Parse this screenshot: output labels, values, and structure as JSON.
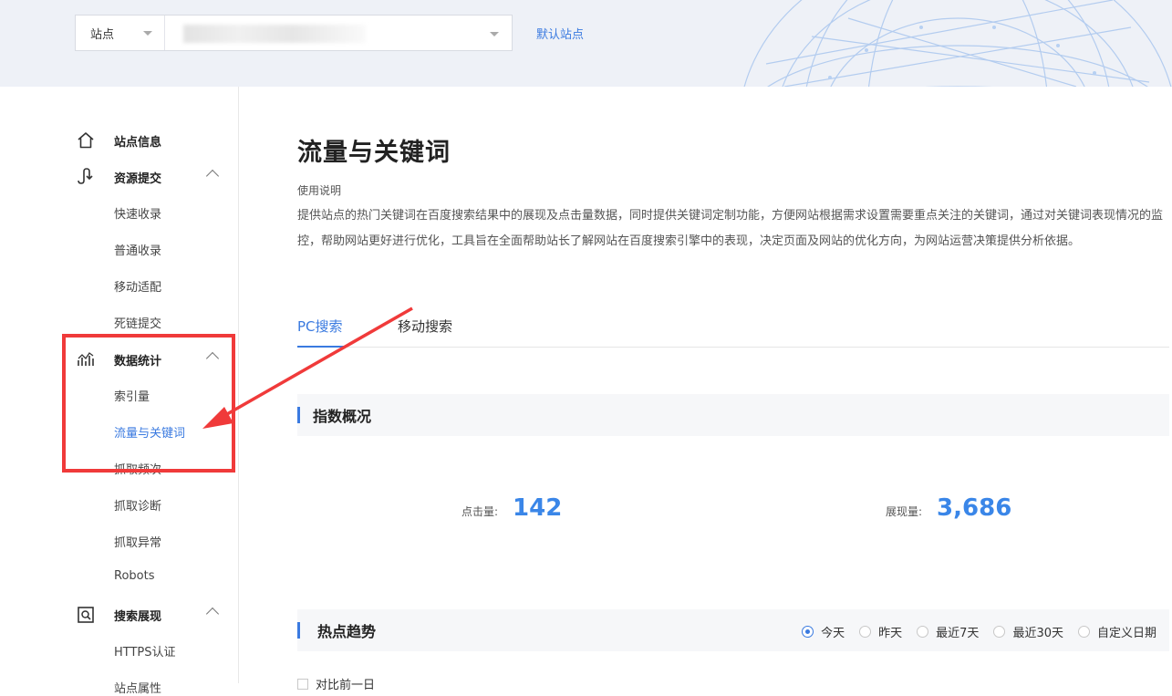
{
  "header": {
    "site_type_label": "站点",
    "default_site_link": "默认站点"
  },
  "sidebar": {
    "groups": [
      {
        "label": "站点信息",
        "icon": "home-icon"
      },
      {
        "label": "资源提交",
        "icon": "submit-icon",
        "items": [
          "快速收录",
          "普通收录",
          "移动适配",
          "死链提交"
        ]
      },
      {
        "label": "数据统计",
        "icon": "stats-icon",
        "items": [
          "索引量",
          "流量与关键词",
          "抓取频次",
          "抓取诊断",
          "抓取异常",
          "Robots"
        ]
      },
      {
        "label": "搜索展现",
        "icon": "search-display-icon",
        "items": [
          "HTTPS认证",
          "站点属性"
        ]
      }
    ],
    "active_item": "流量与关键词"
  },
  "main": {
    "title": "流量与关键词",
    "usage_label": "使用说明",
    "description": "提供站点的热门关键词在百度搜索结果中的展现及点击量数据，同时提供关键词定制功能，方便网站根据需求设置需要重点关注的关键词，通过对关键词表现情况的监控，帮助网站更好进行优化，工具旨在全面帮助站长了解网站在百度搜索引擎中的表现，决定页面及网站的优化方向，为网站运营决策提供分析依据。",
    "tabs": [
      {
        "label": "PC搜索",
        "active": true
      },
      {
        "label": "移动搜索",
        "active": false
      }
    ],
    "overview": {
      "title": "指数概况",
      "clicks_label": "点击量:",
      "clicks_value": "142",
      "impressions_label": "展现量:",
      "impressions_value": "3,686"
    },
    "trend": {
      "title": "热点趋势",
      "ranges": [
        {
          "label": "今天",
          "checked": true
        },
        {
          "label": "昨天",
          "checked": false
        },
        {
          "label": "最近7天",
          "checked": false
        },
        {
          "label": "最近30天",
          "checked": false
        },
        {
          "label": "自定义日期",
          "checked": false
        }
      ],
      "compare_label": "对比前一日"
    }
  },
  "colors": {
    "accent": "#3a7ae0",
    "highlight": "#f03a3a",
    "value": "#3a86e8"
  }
}
